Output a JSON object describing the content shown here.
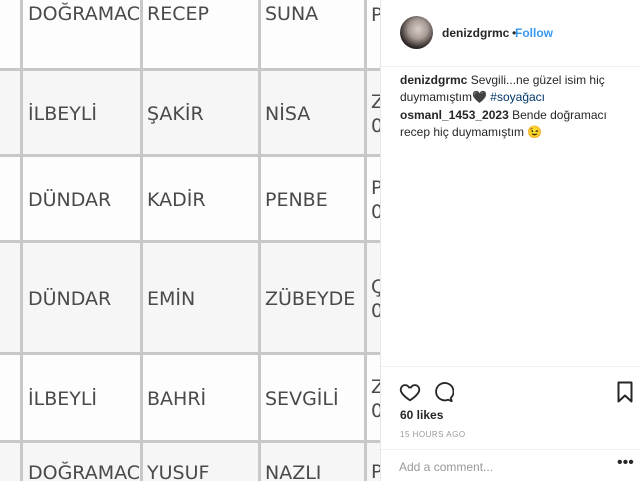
{
  "table": {
    "rows": [
      {
        "c0": "DOĞRAMACI",
        "c1": "RECEP",
        "c2": "SUNA",
        "c3a": "P",
        "c3b": ""
      },
      {
        "c0": "İLBEYLİ",
        "c1": "ŞAKİR",
        "c2": "NİSA",
        "c3a": "Z",
        "c3b": "0"
      },
      {
        "c0": "DÜNDAR",
        "c1": "KADİR",
        "c2": "PENBE",
        "c3a": "P",
        "c3b": "0"
      },
      {
        "c0": "DÜNDAR",
        "c1": "EMİN",
        "c2": "ZÜBEYDE",
        "c3a": "Ç",
        "c3b": "0"
      },
      {
        "c0": "İLBEYLİ",
        "c1": "BAHRİ",
        "c2": "SEVGİLİ",
        "c3a": "Z",
        "c3b": "0"
      },
      {
        "c0": "DOĞRAMACI",
        "c1": "YUSUF",
        "c2": "NAZLI",
        "c3a": "P",
        "c3b": ""
      }
    ]
  },
  "post": {
    "username": "denizdgrmc",
    "dot": "•",
    "follow": "Follow",
    "caption": {
      "user": "denizdgrmc",
      "text": "Sevgili...ne güzel isim hiç duymamıştım🖤",
      "tag": "#soyağacı"
    },
    "comment": {
      "user": "osmanl_1453_2023",
      "text": "Bende doğramacı recep hiç duymamıştım 😉"
    },
    "likes": "60 likes",
    "time": "15 HOURS AGO",
    "add_comment_placeholder": "Add a comment...",
    "more": "•••"
  }
}
